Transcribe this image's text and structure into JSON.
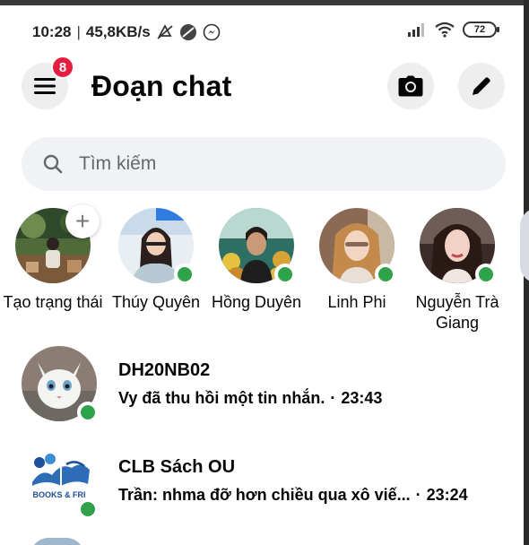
{
  "status_bar": {
    "time": "10:28",
    "network_speed": "45,8KB/s",
    "battery": "72",
    "icons": [
      "mute-icon",
      "dnd-icon",
      "messenger-icon",
      "signal-icon",
      "wifi-icon",
      "battery-icon"
    ]
  },
  "header": {
    "title": "Đoạn chat",
    "menu_badge": "8"
  },
  "search": {
    "placeholder": "Tìm kiếm"
  },
  "stories": [
    {
      "name": "Tạo trạng thái",
      "online": false,
      "add": true
    },
    {
      "name": "Thúy Quyên",
      "online": true
    },
    {
      "name": "Hồng Duyên",
      "online": true
    },
    {
      "name": "Linh Phi",
      "online": true
    },
    {
      "name": "Nguyễn Trà Giang",
      "online": true
    }
  ],
  "chats": [
    {
      "name": "DH20NB02",
      "preview": "Vy đã thu hồi một tin nhắn.",
      "time": "23:43",
      "online": true
    },
    {
      "name": "CLB Sách OU",
      "preview": "Trần: nhma đỡ hơn chiều qua xô viế...",
      "time": "23:24",
      "online": true,
      "logo_text": "BOOKS & FRI"
    }
  ],
  "colors": {
    "online": "#31a24c",
    "badge": "#e41e3f",
    "surface": "#f0f2f5",
    "text": "#050505",
    "secondary": "#65676b"
  }
}
